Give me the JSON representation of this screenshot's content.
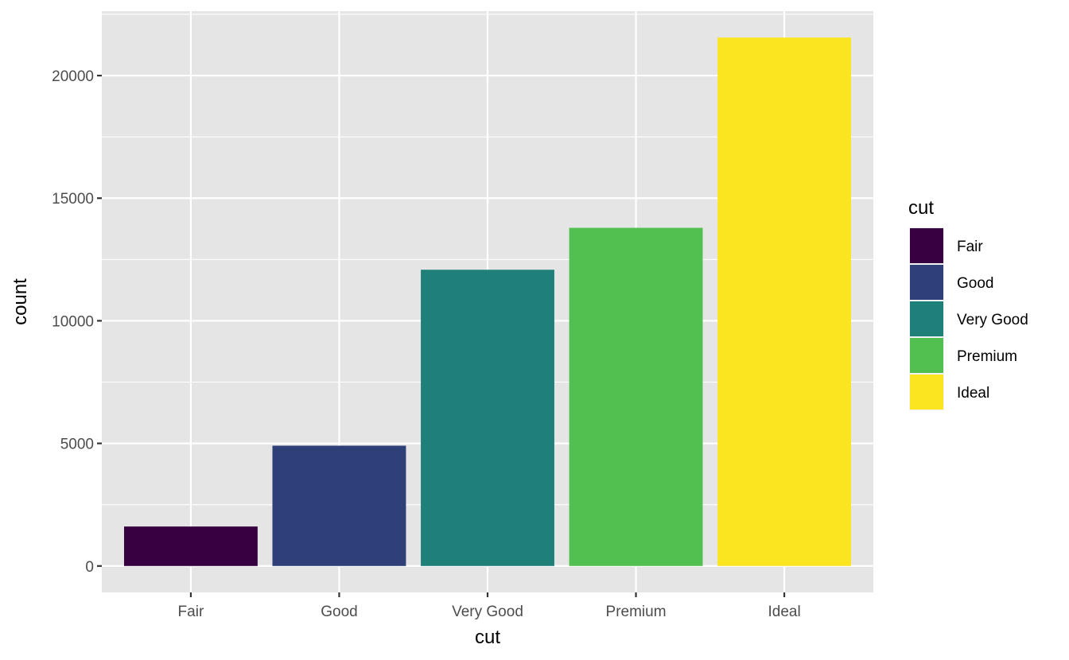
{
  "chart_data": {
    "type": "bar",
    "title": "",
    "xlabel": "cut",
    "ylabel": "count",
    "categories": [
      "Fair",
      "Good",
      "Very Good",
      "Premium",
      "Ideal"
    ],
    "values": [
      1610,
      4906,
      12082,
      13791,
      21551
    ],
    "colors": [
      "#440154",
      "#3B528B",
      "#21908C",
      "#5DC863",
      "#FDE725"
    ],
    "bar_colors_rendered": [
      "#360041",
      "#2F3F78",
      "#1F8079",
      "#52C050",
      "#FBE521"
    ],
    "ylim": [
      -1077.55,
      22628.55
    ],
    "yticks": [
      0,
      5000,
      10000,
      15000,
      20000
    ],
    "ytick_labels": [
      "0",
      "5000",
      "10000",
      "15000",
      "20000"
    ],
    "yminor": [
      2500,
      7500,
      12500,
      17500,
      22500
    ],
    "grid": true,
    "theme": "ggplot2 grey",
    "panel_background": "#E5E5E5",
    "grid_color": "#FFFFFF",
    "legend": {
      "title": "cut",
      "placement": "right",
      "entries": [
        "Fair",
        "Good",
        "Very Good",
        "Premium",
        "Ideal"
      ]
    }
  }
}
